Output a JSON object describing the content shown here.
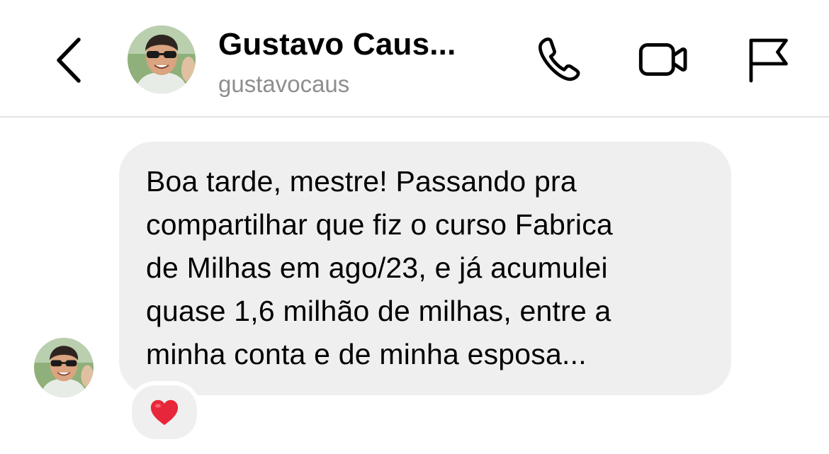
{
  "header": {
    "back_icon": "chevron-left-icon",
    "name": "Gustavo Caus...",
    "username": "gustavocaus",
    "actions": {
      "call_icon": "phone-icon",
      "video_icon": "video-camera-icon",
      "report_icon": "flag-icon"
    }
  },
  "thread": {
    "messages": [
      {
        "text": "Boa tarde, mestre! Passando pra\ncompartilhar que fiz o curso Fabrica\nde Milhas em ago/23, e já acumulei\nquase 1,6 milhão de milhas, entre a\nminha conta e de minha esposa...",
        "reaction": "❤️"
      }
    ]
  },
  "colors": {
    "bubble": "#efefef",
    "username": "#8e8e8e",
    "divider": "#e3e3e3",
    "heart": "#e8263a"
  }
}
